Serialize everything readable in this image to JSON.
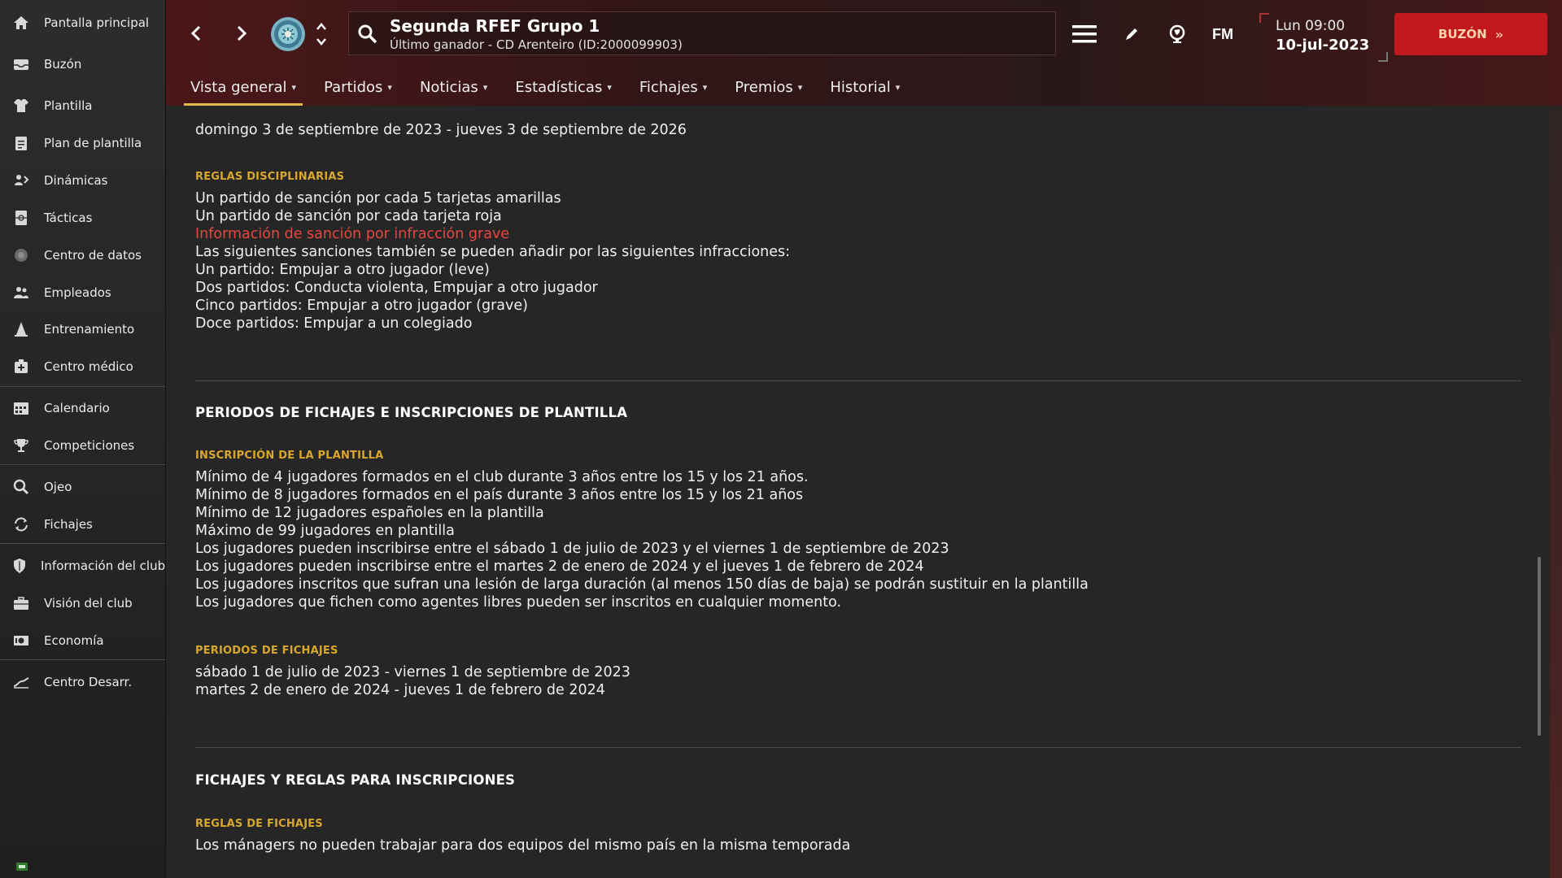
{
  "sidebar": {
    "items": [
      {
        "label": "Pantalla principal",
        "icon": "home-icon"
      },
      {
        "label": "Buzón",
        "icon": "inbox-icon"
      },
      {
        "label": "Plantilla",
        "icon": "shirt-icon"
      },
      {
        "label": "Plan de plantilla",
        "icon": "clipboard-icon"
      },
      {
        "label": "Dinámicas",
        "icon": "dynamics-icon"
      },
      {
        "label": "Tácticas",
        "icon": "tactics-icon"
      },
      {
        "label": "Centro de datos",
        "icon": "data-hub-icon"
      },
      {
        "label": "Empleados",
        "icon": "staff-icon"
      },
      {
        "label": "Entrenamiento",
        "icon": "training-cone-icon"
      },
      {
        "label": "Centro médico",
        "icon": "medical-icon"
      },
      {
        "label": "Calendario",
        "icon": "calendar-icon"
      },
      {
        "label": "Competiciones",
        "icon": "trophy-icon"
      },
      {
        "label": "Ojeo",
        "icon": "scouting-icon"
      },
      {
        "label": "Fichajes",
        "icon": "transfers-icon"
      },
      {
        "label": "Información del club",
        "icon": "shield-icon"
      },
      {
        "label": "Visión del club",
        "icon": "briefcase-icon"
      },
      {
        "label": "Economía",
        "icon": "finances-icon"
      },
      {
        "label": "Centro Desarr.",
        "icon": "development-icon"
      }
    ]
  },
  "header": {
    "competition_title": "Segunda RFEF Grupo 1",
    "competition_subtitle": "Último ganador - CD Arenteiro (ID:2000099903)",
    "fm_logo": "FM",
    "time": "Lun 09:00",
    "date": "10-jul-2023",
    "inbox_button": "BUZÓN",
    "accent_color": "#c0181b"
  },
  "tabs": [
    {
      "label": "Vista general"
    },
    {
      "label": "Partidos"
    },
    {
      "label": "Noticias"
    },
    {
      "label": "Estadísticas"
    },
    {
      "label": "Fichajes"
    },
    {
      "label": "Premios"
    },
    {
      "label": "Historial"
    }
  ],
  "content": {
    "period_line": "domingo 3 de septiembre de 2023 - jueves 3 de septiembre de 2026",
    "disciplinary": {
      "heading": "REGLAS DISCIPLINARIAS",
      "lines": [
        "Un partido de sanción por cada 5 tarjetas amarillas",
        "Un partido de sanción por cada tarjeta roja"
      ],
      "link": "Información de sanción por infracción grave",
      "extra_lines": [
        "Las siguientes sanciones también se pueden añadir por las siguientes infracciones:",
        "Un partido: Empujar a otro jugador (leve)",
        "Dos partidos: Conducta violenta, Empujar a otro jugador",
        "Cinco partidos: Empujar a otro jugador (grave)",
        "Doce partidos: Empujar a un colegiado"
      ]
    },
    "section2": {
      "title": "PERIODOS DE FICHAJES E INSCRIPCIONES DE PLANTILLA",
      "registration_heading": "INSCRIPCIÓN DE LA PLANTILLA",
      "registration_lines": [
        "Mínimo de 4 jugadores formados en el club durante 3 años entre los 15 y los 21 años.",
        "Mínimo de 8 jugadores formados en el país durante 3 años entre los 15 y los 21 años",
        "Mínimo de 12 jugadores españoles en la plantilla",
        "Máximo de 99 jugadores en plantilla",
        "Los jugadores pueden inscribirse entre el sábado 1 de julio de 2023 y el viernes 1 de septiembre de 2023",
        "Los jugadores pueden inscribirse entre el martes 2 de enero de 2024 y el jueves 1 de febrero de 2024",
        "Los jugadores inscritos que sufran una lesión de larga duración (al menos 150 días de baja) se podrán sustituir en la plantilla",
        "Los jugadores que fichen como agentes libres pueden ser inscritos en cualquier momento."
      ],
      "windows_heading": "PERIODOS DE FICHAJES",
      "windows_lines": [
        "sábado 1 de julio de 2023 - viernes 1 de septiembre de 2023",
        "martes 2 de enero de 2024 - jueves 1 de febrero de 2024"
      ]
    },
    "section3": {
      "title": "FICHAJES Y REGLAS PARA INSCRIPCIONES",
      "rules_heading": "REGLAS DE FICHAJES",
      "rules_lines": [
        "Los mánagers no pueden trabajar para dos equipos del mismo país en la misma temporada"
      ]
    }
  }
}
